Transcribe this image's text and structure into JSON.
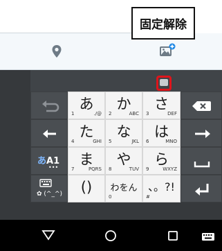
{
  "callout": {
    "label": "固定解除"
  },
  "keyboard": {
    "keys": [
      {
        "main": "あ",
        "num": "1",
        "letters": "./@"
      },
      {
        "main": "か",
        "num": "2",
        "letters": "ABC"
      },
      {
        "main": "さ",
        "num": "3",
        "letters": "DEF"
      },
      {
        "main": "た",
        "num": "4",
        "letters": "GHI"
      },
      {
        "main": "な",
        "num": "5",
        "letters": "JKL"
      },
      {
        "main": "は",
        "num": "6",
        "letters": "MNO"
      },
      {
        "main": "ま",
        "num": "7",
        "letters": "PQRS"
      },
      {
        "main": "や",
        "num": "8",
        "letters": "TUV"
      },
      {
        "main": "ら",
        "num": "9",
        "letters": "WXYZ"
      },
      {
        "main": "()",
        "num": "",
        "letters": ""
      },
      {
        "main": "わをん",
        "num": "0",
        "letters": ""
      },
      {
        "main": "、。?!",
        "num": "#",
        "letters": ""
      }
    ],
    "mode_key": {
      "main": "あA1",
      "dots": "•••"
    },
    "emoji_key": {
      "label": "(^_^)"
    }
  },
  "colors": {
    "accent": "#e0141b",
    "keyboard_bg": "#36393c",
    "key_bg": "#f4f4f4",
    "toolbar_bg": "#f4f8fb",
    "icon_blue": "#1e88e5"
  }
}
